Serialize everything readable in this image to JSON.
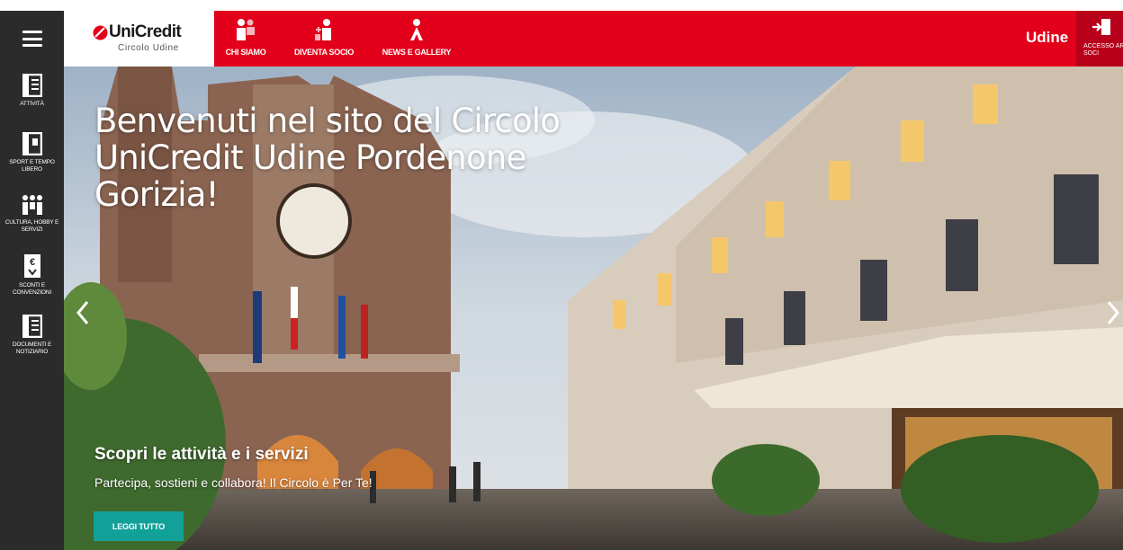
{
  "brand": {
    "name": "UniCredit",
    "subtitle": "Circolo Udine"
  },
  "nav": {
    "items": [
      {
        "label": "CHI SIAMO",
        "icon": "people-icon"
      },
      {
        "label": "DIVENTA SOCIO",
        "icon": "person-add-icon"
      },
      {
        "label": "NEWS E GALLERY",
        "icon": "person-star-icon"
      }
    ],
    "city": "Udine",
    "login_label": "ACCESSO AREA SOCI"
  },
  "sidebar": {
    "items": [
      {
        "label": "ATTIVITÀ",
        "icon": "document-icon"
      },
      {
        "label": "SPORT E TEMPO LIBERO",
        "icon": "ticket-icon"
      },
      {
        "label": "CULTURA, HOBBY E SERVIZI",
        "icon": "group-icon"
      },
      {
        "label": "SCONTI E CONVENZIONI",
        "icon": "euro-discount-icon"
      },
      {
        "label": "DOCUMENTI E NOTIZIARIO",
        "icon": "newspaper-icon"
      }
    ]
  },
  "hero": {
    "title": "Benvenuti nel sito del Circolo UniCredit Udine Pordenone Gorizia!",
    "subtitle": "Scopri le attività e i servizi",
    "text": "Partecipa, sostieni e collabora! Il Circolo è Per Te!",
    "button": "LEGGI TUTTO"
  },
  "colors": {
    "primary_red": "#e2001a",
    "dark_red": "#b8001a",
    "sidebar": "#2b2b2b",
    "button": "#12a199"
  }
}
